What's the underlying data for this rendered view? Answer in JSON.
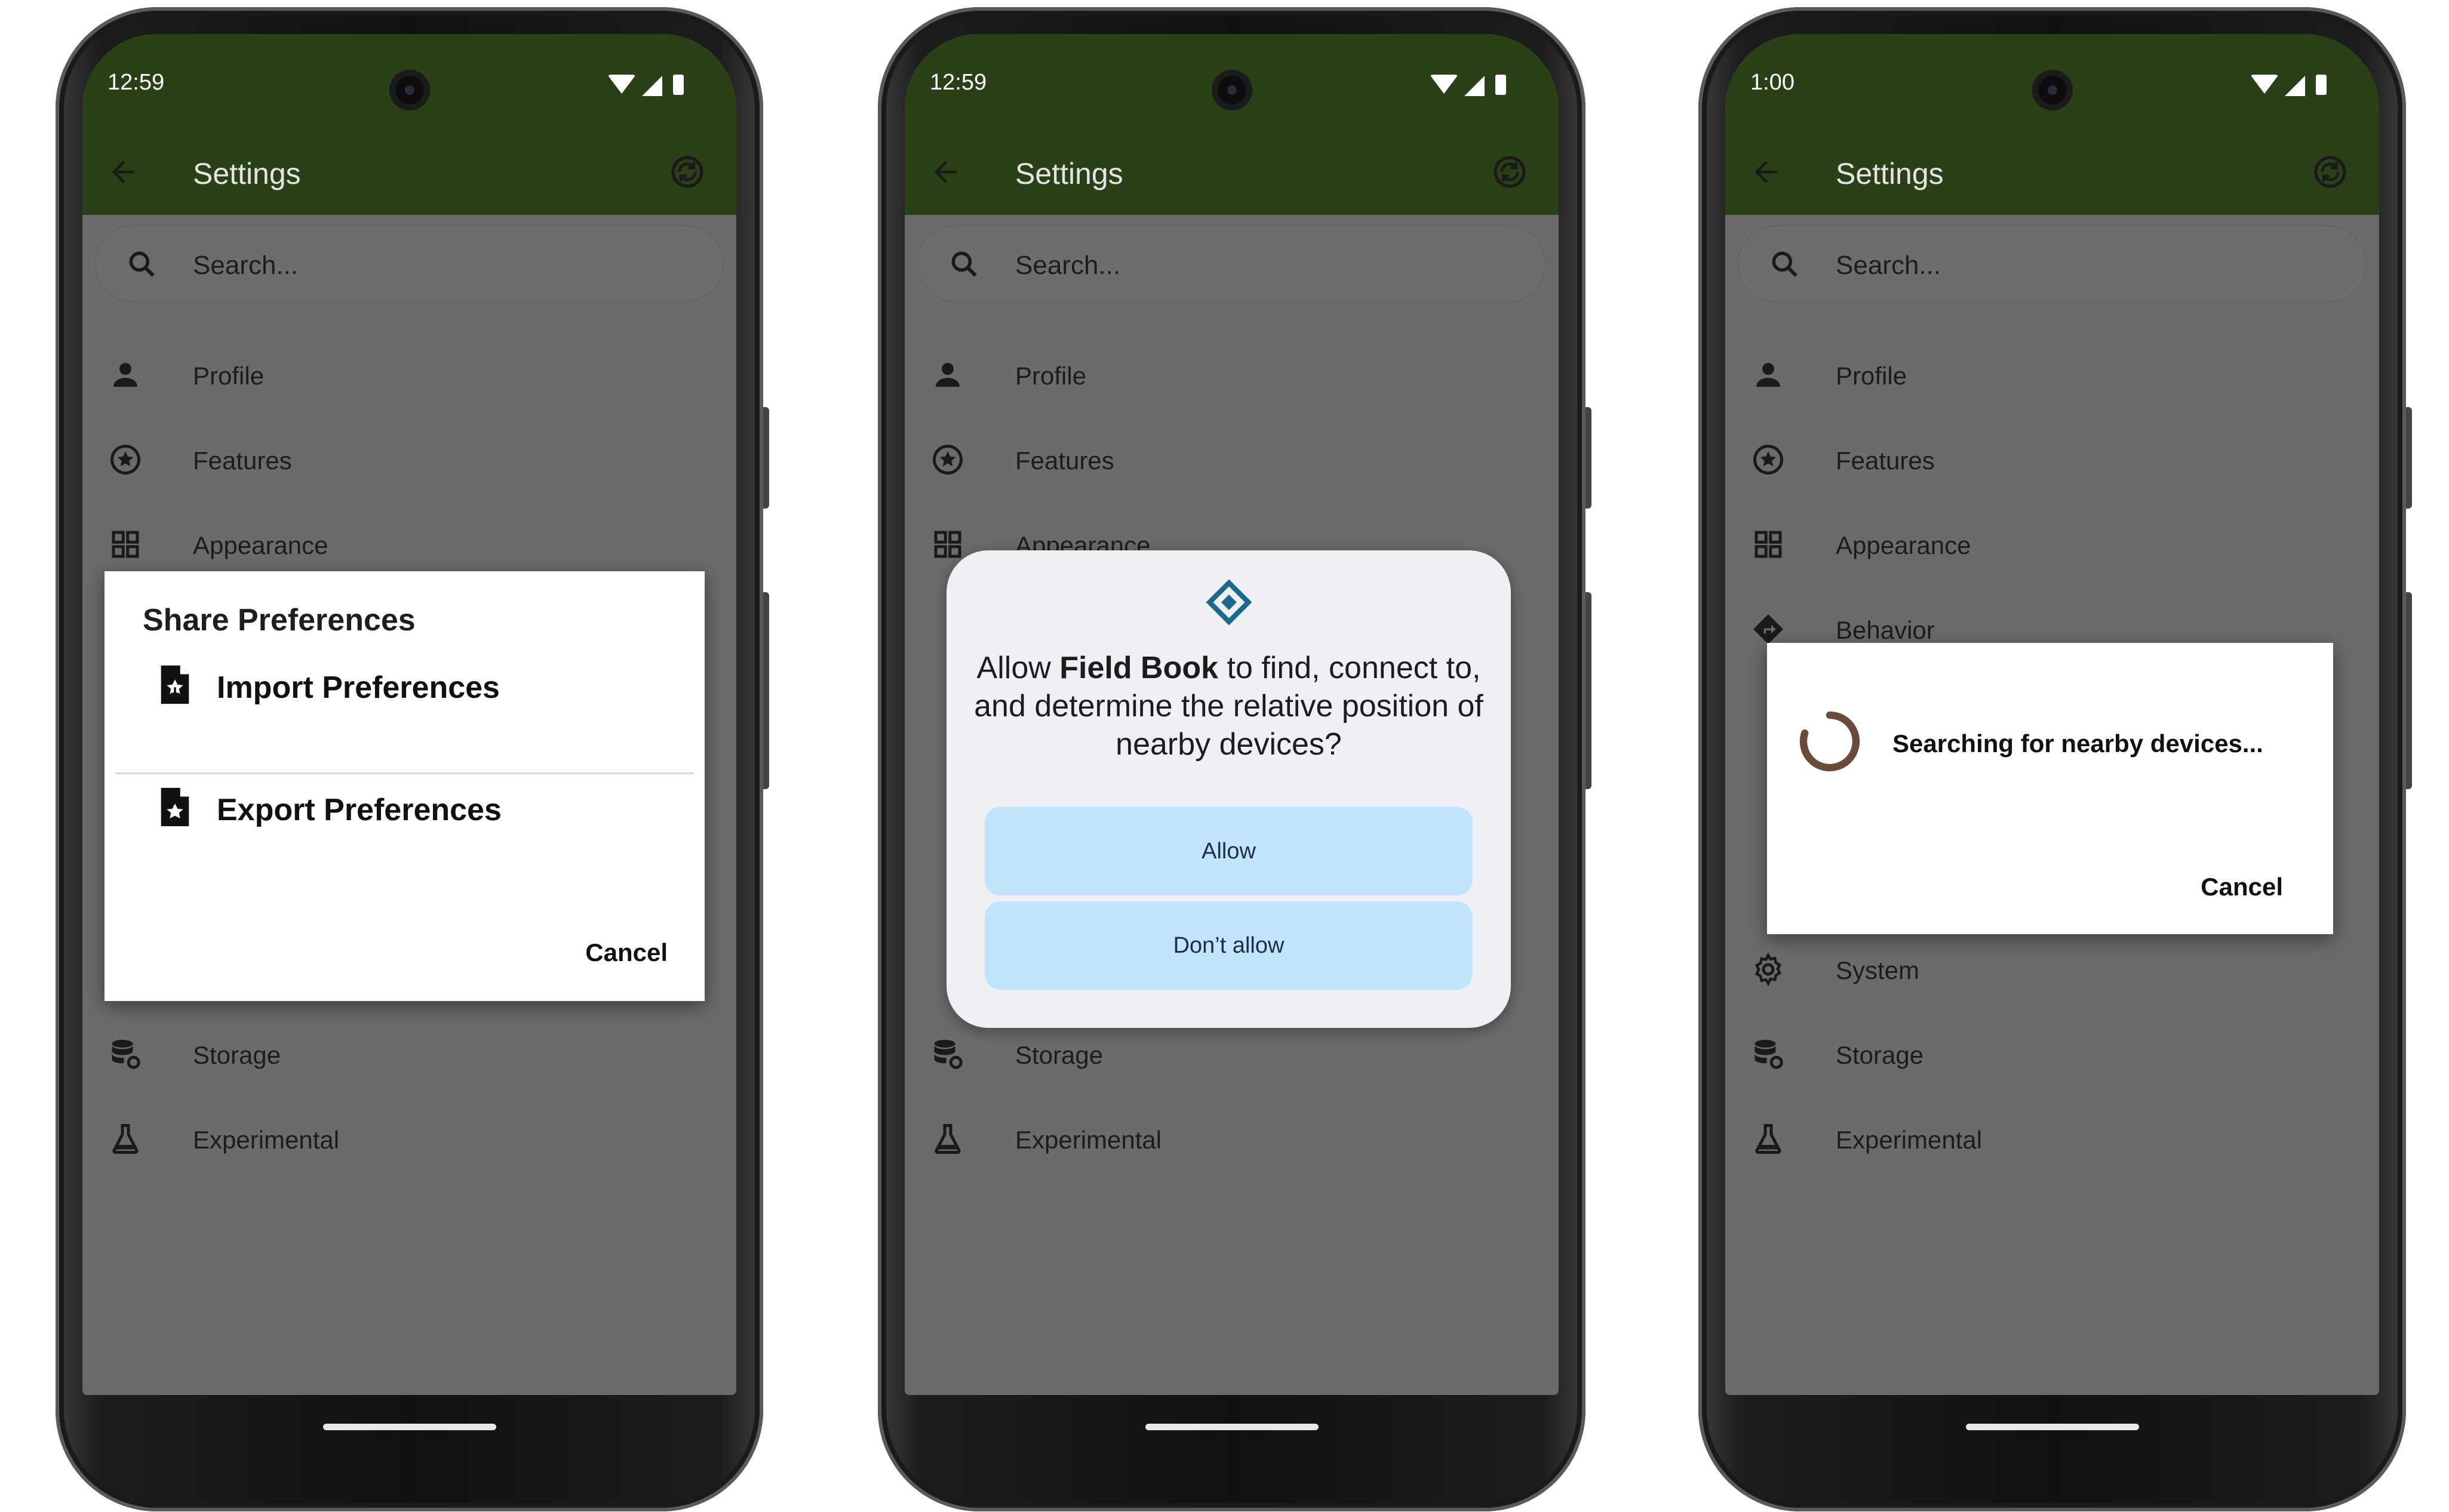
{
  "colors": {
    "app_bar": "#2a4016",
    "scrim_background": "#6b6b6b",
    "permission_button": "#bfe4fb",
    "permission_icon": "#1b6a8c",
    "spinner": "#6a4a3a"
  },
  "phones": [
    {
      "status": {
        "time": "12:59"
      },
      "appbar": {
        "title": "Settings",
        "back_icon": "arrow-back-icon",
        "action_icon": "sync-icon"
      },
      "search": {
        "placeholder": "Search..."
      },
      "settings": [
        {
          "label": "Profile",
          "icon": "person-icon"
        },
        {
          "label": "Features",
          "icon": "star-circle-icon"
        },
        {
          "label": "Appearance",
          "icon": "grid-icon"
        },
        {
          "label": "Storage",
          "icon": "database-settings-icon"
        },
        {
          "label": "Experimental",
          "icon": "flask-icon"
        }
      ],
      "dialog": {
        "title": "Share Preferences",
        "import_label": "Import Preferences",
        "export_label": "Export Preferences",
        "cancel": "Cancel"
      }
    },
    {
      "status": {
        "time": "12:59"
      },
      "appbar": {
        "title": "Settings",
        "back_icon": "arrow-back-icon",
        "action_icon": "sync-icon"
      },
      "search": {
        "placeholder": "Search..."
      },
      "settings": [
        {
          "label": "Profile",
          "icon": "person-icon"
        },
        {
          "label": "Features",
          "icon": "star-circle-icon"
        },
        {
          "label": "Appearance",
          "icon": "grid-icon"
        },
        {
          "label": "Storage",
          "icon": "database-settings-icon"
        },
        {
          "label": "Experimental",
          "icon": "flask-icon"
        }
      ],
      "permission": {
        "icon": "nearby-devices-icon",
        "text_before": "Allow ",
        "app_name": "Field Book",
        "text_after": " to find, connect to, and determine the relative position of nearby devices?",
        "allow": "Allow",
        "deny": "Don’t allow"
      }
    },
    {
      "status": {
        "time": "1:00"
      },
      "appbar": {
        "title": "Settings",
        "back_icon": "arrow-back-icon",
        "action_icon": "sync-icon"
      },
      "search": {
        "placeholder": "Search..."
      },
      "settings": [
        {
          "label": "Profile",
          "icon": "person-icon"
        },
        {
          "label": "Features",
          "icon": "star-circle-icon"
        },
        {
          "label": "Appearance",
          "icon": "grid-icon"
        },
        {
          "label": "Behavior",
          "icon": "directions-icon"
        },
        {
          "label": "System",
          "icon": "gear-icon"
        },
        {
          "label": "Storage",
          "icon": "database-settings-icon"
        },
        {
          "label": "Experimental",
          "icon": "flask-icon"
        }
      ],
      "progress": {
        "message": "Searching for nearby devices...",
        "cancel": "Cancel"
      }
    }
  ]
}
